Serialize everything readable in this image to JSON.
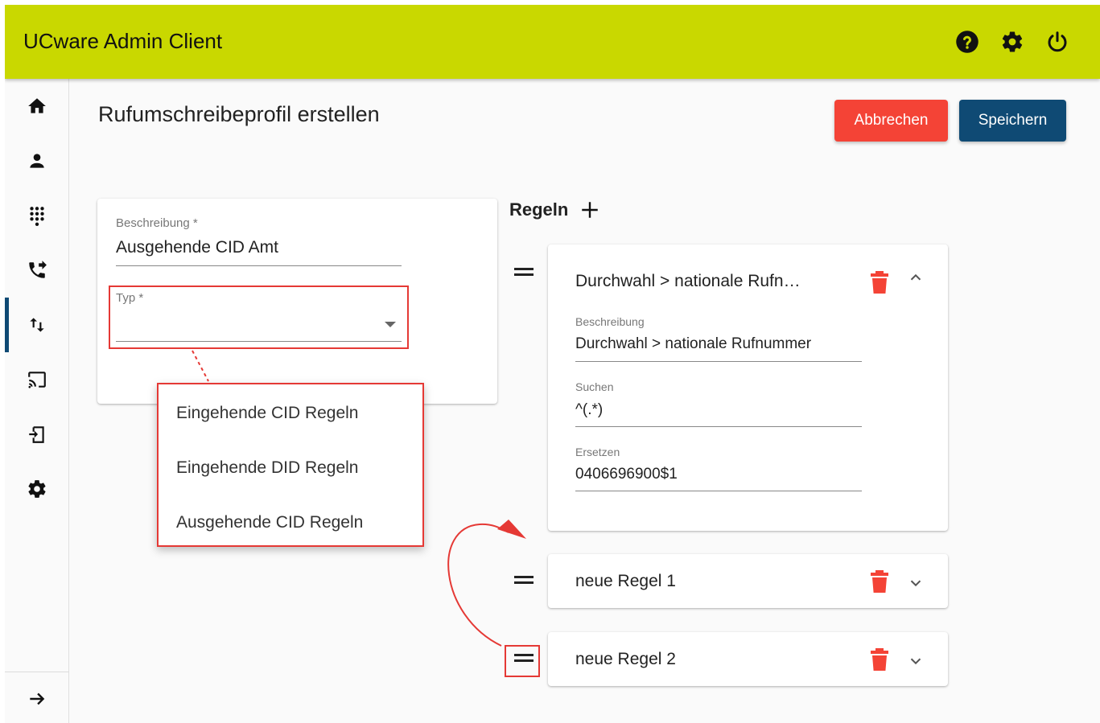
{
  "app": {
    "title": "UCware Admin Client"
  },
  "header_icons": [
    "help-icon",
    "settings-icon",
    "power-icon"
  ],
  "sidebar": {
    "items": [
      {
        "icon": "home-icon"
      },
      {
        "icon": "user-icon"
      },
      {
        "icon": "dialpad-icon"
      },
      {
        "icon": "phone-forward-icon"
      },
      {
        "icon": "swap-vert-icon",
        "active": true
      },
      {
        "icon": "cast-icon"
      },
      {
        "icon": "phone-login-icon"
      },
      {
        "icon": "gear-icon"
      }
    ],
    "collapse_icon": "arrow-right-icon"
  },
  "page": {
    "title": "Rufumschreibeprofil erstellen",
    "cancel_label": "Abbrechen",
    "save_label": "Speichern"
  },
  "form": {
    "beschreibung_label": "Beschreibung *",
    "beschreibung_value": "Ausgehende CID Amt",
    "typ_label": "Typ *",
    "typ_value": ""
  },
  "typ_options": [
    "Eingehende CID Regeln",
    "Eingehende DID Regeln",
    "Ausgehende CID Regeln"
  ],
  "rules": {
    "title": "Regeln",
    "items": [
      {
        "title": "Durchwahl > nationale Rufn…",
        "expanded": true,
        "beschreibung_label": "Beschreibung",
        "beschreibung_value": "Durchwahl > nationale Rufnummer",
        "suchen_label": "Suchen",
        "suchen_value": "^(.*)",
        "ersetzen_label": "Ersetzen",
        "ersetzen_value": "0406696900$1"
      },
      {
        "title": "neue Regel 1",
        "expanded": false
      },
      {
        "title": "neue Regel 2",
        "expanded": false
      }
    ]
  },
  "colors": {
    "header": "#c9d800",
    "primary": "#0f4a74",
    "danger": "#f44336",
    "annotation": "#e53935"
  }
}
